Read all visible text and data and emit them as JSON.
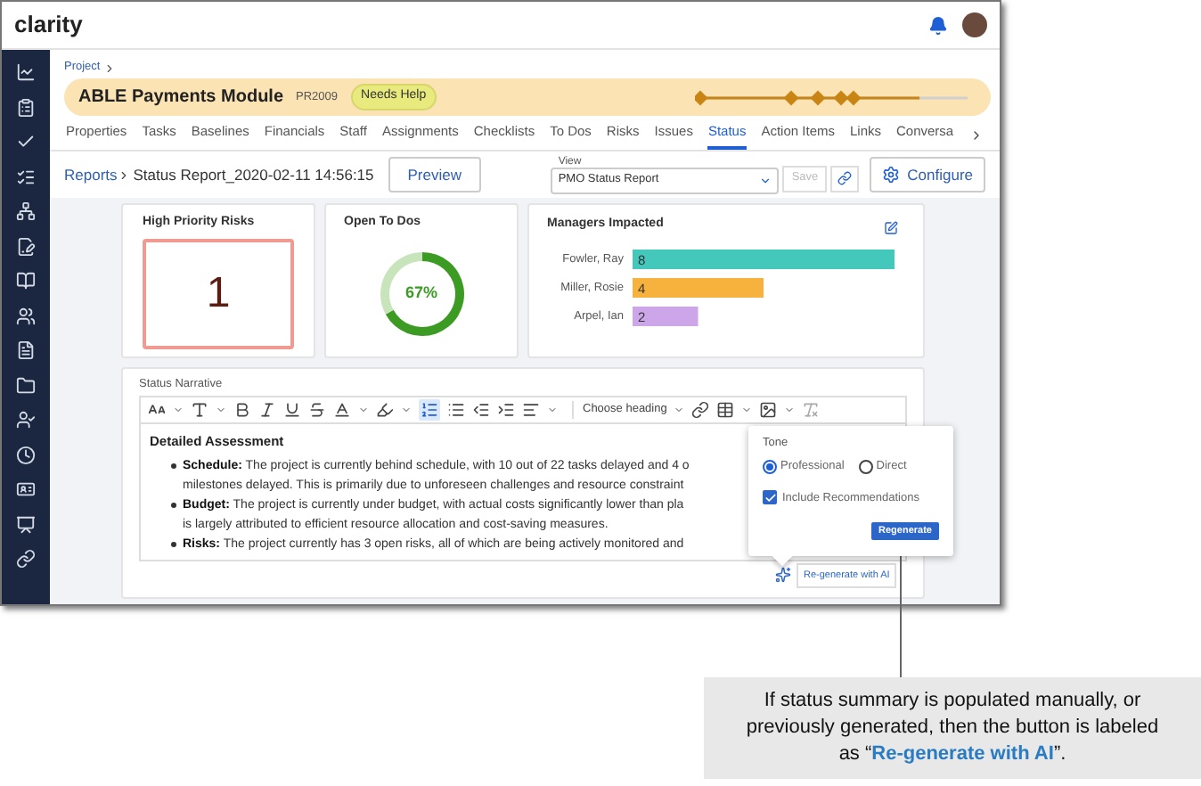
{
  "header": {
    "logo": "clarity"
  },
  "breadcrumb": {
    "label": "Project"
  },
  "project": {
    "title": "ABLE Payments Module",
    "code": "PR2009",
    "status": "Needs Help",
    "timeline": {
      "level": 0.82
    }
  },
  "tabs": [
    {
      "label": "Properties",
      "selected": false
    },
    {
      "label": "Tasks",
      "selected": false
    },
    {
      "label": "Baselines",
      "selected": false
    },
    {
      "label": "Financials",
      "selected": false
    },
    {
      "label": "Staff",
      "selected": false
    },
    {
      "label": "Assignments",
      "selected": false
    },
    {
      "label": "Checklists",
      "selected": false
    },
    {
      "label": "To Dos",
      "selected": false
    },
    {
      "label": "Risks",
      "selected": false
    },
    {
      "label": "Issues",
      "selected": false
    },
    {
      "label": "Status",
      "selected": true
    },
    {
      "label": "Action Items",
      "selected": false
    },
    {
      "label": "Links",
      "selected": false
    },
    {
      "label": "Conversa",
      "selected": false
    }
  ],
  "report_bar": {
    "parent": "Reports",
    "title": "Status Report_2020-02-11 14:56:15",
    "preview": "Preview",
    "view_label": "View",
    "view_value": "PMO Status Report",
    "save": "Save",
    "save_disabled": true,
    "configure": "Configure"
  },
  "risks_card": {
    "title": "High Priority Risks",
    "value": "1"
  },
  "todos_card": {
    "title": "Open To Dos",
    "chart_data": {
      "type": "donut",
      "values": [
        67,
        33
      ],
      "colors": [
        "#3b9b23",
        "#c7e4bb"
      ],
      "annotations": [
        "67%"
      ]
    }
  },
  "managers_card": {
    "title": "Managers Impacted",
    "chart_data": {
      "type": "bar",
      "orientation": "horizontal",
      "categories": [
        "Fowler, Ray",
        "Miller, Rosie",
        "Arpel, Ian"
      ],
      "values": [
        8,
        4,
        2
      ],
      "colors": [
        "#45c8bc",
        "#f7b23e",
        "#cca6e8"
      ],
      "data_labels": true
    }
  },
  "narrative": {
    "title": "Status Narrative",
    "heading_placeholder": "Choose heading",
    "numbered_list_selected": true,
    "heading": "Detailed Assessment",
    "bullets": [
      {
        "label": "Schedule:",
        "lines": [
          " The project is currently behind schedule, with 10 out of 22 tasks delayed and 4 o",
          "milestones delayed. This is primarily due to unforeseen challenges and resource constraint"
        ]
      },
      {
        "label": "Budget:",
        "lines": [
          " The project is currently under budget, with actual costs significantly lower than pla",
          "is largely attributed to efficient resource allocation and cost-saving measures."
        ]
      },
      {
        "label": "Risks:",
        "lines": [
          " The project currently has 3 open risks, all of which are being actively monitored and"
        ]
      }
    ],
    "regenerate_link": "Re-generate with AI"
  },
  "popover": {
    "tone_label": "Tone",
    "options": [
      {
        "label": "Professional",
        "selected": true
      },
      {
        "label": "Direct",
        "selected": false
      }
    ],
    "recommendations": {
      "label": "Include Recommendations",
      "checked": true
    },
    "button": "Regenerate"
  },
  "callout": {
    "before": "If status summary is populated manually, or previously generated, then the button is labeled as “",
    "highlight": "Re-generate with AI",
    "after": "”."
  }
}
